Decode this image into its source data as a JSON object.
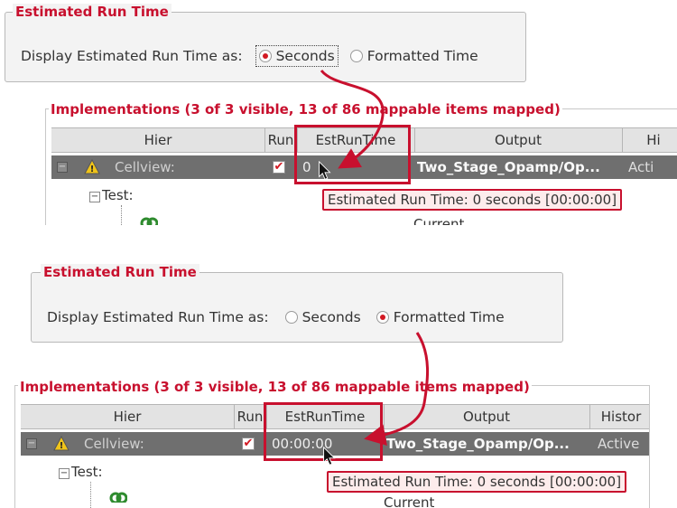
{
  "top_settings": {
    "group_title": "Estimated Run Time",
    "label": "Display Estimated Run Time as:",
    "option_seconds": "Seconds",
    "option_formatted": "Formatted Time",
    "selected": "seconds"
  },
  "top_impl": {
    "title": "Implementations (3 of 3 visible, 13 of 86 mappable items mapped)",
    "columns": [
      "Hier",
      "Run",
      "EstRunTime",
      "Output",
      "Hi"
    ],
    "row": {
      "hier": "Cellview:",
      "run_checked": true,
      "est": "0",
      "output": "Two_Stage_Opamp/Op...",
      "history": "Acti"
    },
    "child": "Test:",
    "tooltip": "Estimated Run Time: 0 seconds [00:00:00]",
    "partial_text": "Current"
  },
  "bottom_settings": {
    "group_title": "Estimated Run Time",
    "label": "Display Estimated Run Time as:",
    "option_seconds": "Seconds",
    "option_formatted": "Formatted Time",
    "selected": "formatted"
  },
  "bottom_impl": {
    "title": "Implementations (3 of 3 visible, 13 of 86 mappable items mapped)",
    "columns": [
      "Hier",
      "Run",
      "EstRunTime",
      "Output",
      "Histor"
    ],
    "row": {
      "hier": "Cellview:",
      "run_checked": true,
      "est": "00:00:00",
      "output": "Two_Stage_Opamp/Op...",
      "history": "Active"
    },
    "child": "Test:",
    "tooltip": "Estimated Run Time: 0 seconds [00:00:00]",
    "partial_text": "Current"
  },
  "colors": {
    "accent_red": "#c8102e",
    "selected_row": "#6f6f6f",
    "header_bg": "#e3e3e3"
  }
}
